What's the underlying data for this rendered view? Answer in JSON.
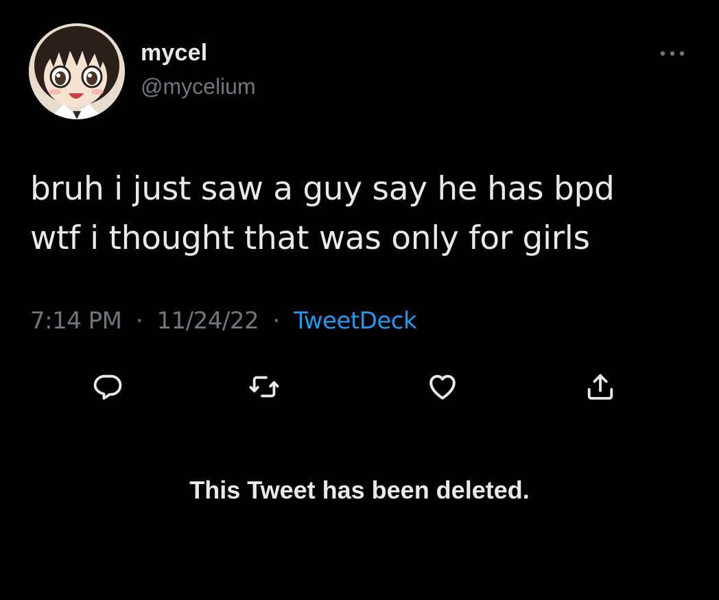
{
  "user": {
    "display_name": "mycel",
    "handle": "@mycelium",
    "avatar_icon": "anime-girl-avatar"
  },
  "tweet": {
    "lines": [
      "bruh i just saw a guy say he has bpd",
      "wtf i thought that was only for girls"
    ],
    "time": "7:14 PM",
    "date": "11/24/22",
    "source": "TweetDeck",
    "separator": "·"
  },
  "actions": {
    "reply_icon": "reply-icon",
    "retweet_icon": "retweet-icon",
    "like_icon": "heart-icon",
    "share_icon": "share-icon"
  },
  "notice": {
    "deleted_text": "This Tweet has been deleted."
  },
  "colors": {
    "background": "#000000",
    "text": "#e7e9ea",
    "secondary": "#71767b",
    "link": "#1d9bf0"
  }
}
